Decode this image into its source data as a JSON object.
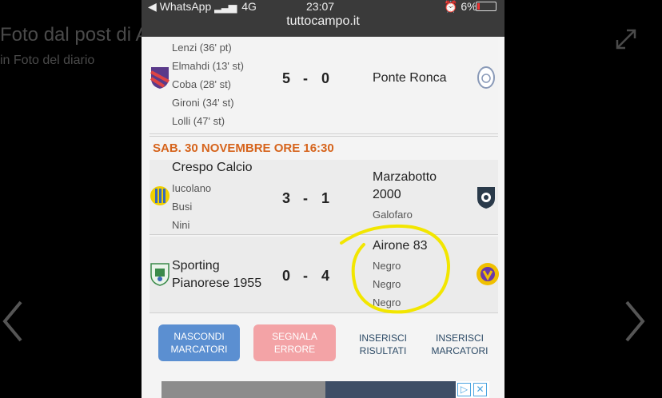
{
  "lightbox": {
    "title": "Foto dal post di Airone Calcio",
    "subtitle": "in Foto del diario",
    "expand_icon": "expand-icon",
    "prev_icon": "chevron-left-icon",
    "next_icon": "chevron-right-icon"
  },
  "status_bar": {
    "left": "◀ WhatsApp",
    "network": "4G",
    "time": "23:07",
    "battery": "6%",
    "url": "tuttocampo.it"
  },
  "match1": {
    "home_scorers": [
      "Lenzi (36' pt)",
      "Elmahdi (13' st)",
      "Coba (28' st)",
      "Gironi (34' st)",
      "Lolli (47' st)"
    ],
    "home_goals": "5",
    "dash": "-",
    "away_goals": "0",
    "away_team": "Ponte Ronca"
  },
  "date_header": "SAB. 30 NOVEMBRE ORE 16:30",
  "match2": {
    "home_team": "Crespo Calcio",
    "home_scorers": [
      "Iucolano",
      "Busi",
      "Nini"
    ],
    "home_goals": "3",
    "dash": "-",
    "away_goals": "1",
    "away_team": [
      "Marzabotto",
      "2000"
    ],
    "away_scorers": [
      "Galofaro"
    ]
  },
  "match3": {
    "home_team": [
      "Sporting",
      "Pianorese 1955"
    ],
    "home_goals": "0",
    "dash": "-",
    "away_goals": "4",
    "away_team": "Airone 83",
    "away_scorers": [
      "Negro",
      "Negro",
      "Negro"
    ]
  },
  "buttons": {
    "hide_scorers": [
      "NASCONDI",
      "MARCATORI"
    ],
    "report_error": [
      "SEGNALA",
      "ERRORE"
    ],
    "insert_results": [
      "INSERISCI",
      "RISULTATI"
    ],
    "insert_scorers": [
      "INSERISCI",
      "MARCATORI"
    ]
  },
  "colors": {
    "date_header": "#d6641c",
    "button_blue": "#5b8fd1",
    "button_pink": "#f3a3a6",
    "highlight_circle": "#f2e600"
  }
}
